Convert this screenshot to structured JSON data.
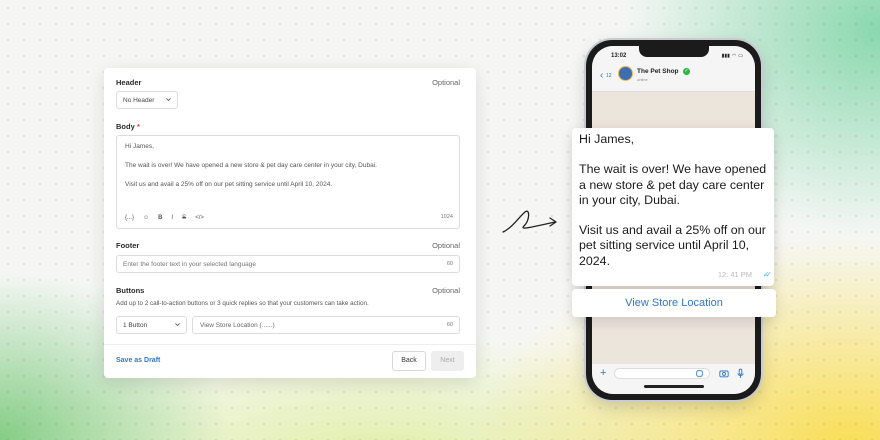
{
  "form": {
    "header": {
      "label": "Header",
      "optional": "Optional",
      "select_value": "No Header"
    },
    "body": {
      "label": "Body",
      "required_mark": "*",
      "lines": [
        "Hi James,",
        "The wait is over! We have opened a new store & pet day care center in your city, Dubai.",
        "Visit us and avail a 25% off on our pet sitting service until April 10, 2024."
      ],
      "toolbar": [
        "{...}",
        "☺",
        "B",
        "I",
        "S",
        "</>"
      ],
      "char_count": "1024"
    },
    "footer": {
      "label": "Footer",
      "optional": "Optional",
      "placeholder": "Enter the footer text in your selected language",
      "char_count": "60"
    },
    "buttons": {
      "label": "Buttons",
      "optional": "Optional",
      "helper": "Add up to 2 call-to-action buttons or 3 quick replies so that your customers can take action.",
      "type_value": "1 Button",
      "text_placeholder": "View Store Location (......)",
      "char_count": "60"
    },
    "actions": {
      "draft": "Save as Draft",
      "back": "Back",
      "next": "Next"
    }
  },
  "phone": {
    "time": "13:02",
    "back_count": "12",
    "contact_name": "The Pet Shop",
    "contact_status": "online"
  },
  "message": {
    "lines": [
      "Hi James,",
      "The wait is over! We have opened a new store & pet day care center in your city, Dubai.",
      "Visit us and avail a 25% off on our pet sitting service until April 10, 2024."
    ],
    "time": "12: 41 PM",
    "cta_label": "View Store Location"
  },
  "colors": {
    "accent": "#2f77c7",
    "verified": "#2cb742",
    "read_ticks": "#4fb6ec"
  }
}
